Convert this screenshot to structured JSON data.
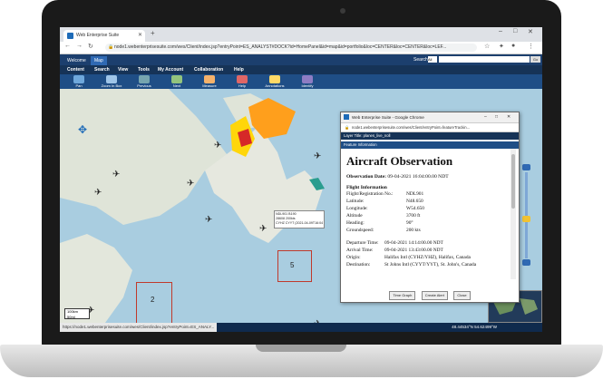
{
  "browser": {
    "tab_title": "Web Enterprise Suite",
    "url": "node1.webenterprisesuite.com/wes/Client/index.jsp?entryPoint=ES_ANALYST#DOCK?id=HomePanel&id=map&id=portfolio&loc=CENTER&loc=CENTER&loc=LEF..."
  },
  "app": {
    "tabs": [
      "Welcome",
      "Map"
    ],
    "search_label": "Search:",
    "search_scope": "All",
    "go_label": "Go",
    "menu": [
      "Content",
      "Search",
      "View",
      "Tools",
      "My Account",
      "Collaboration",
      "Help"
    ],
    "toolbar": [
      "Pan",
      "Zoom In Box",
      "Previous",
      "Next",
      "Measure",
      "Help",
      "Annotations",
      "Identify"
    ]
  },
  "map": {
    "boxes": [
      "2",
      "5"
    ],
    "scale": [
      "100km",
      "50mi"
    ],
    "flight_label": [
      "NDL901 B190",
      "28608 200kts",
      "CYHZ CYYT (2021-04-09T16:04:00Z)"
    ],
    "coordinates": "48.44534°N 54.62499°W",
    "status_url": "https://node1.webenterprisesuite.com/wes/Client/index.jsp?entryPoint=ES_ANALY..."
  },
  "popup": {
    "window_title": "Web Enterprise Suite - Google Chrome",
    "url": "node1.webenterprisesuite.com/wes/Client/entryPoint=featureTrackin...",
    "layer_title": "Layer Title: planes_live_noll",
    "feature_header": "Feature Information",
    "heading": "Aircraft Observation",
    "observation_date_label": "Observation Date:",
    "observation_date": "09-04-2021 16:04:00.00 NDT",
    "section_title": "Flight Information",
    "flight_rows": [
      {
        "key": "Flight/Registration No.:",
        "value": "NDL901"
      },
      {
        "key": "Latitude:",
        "value": "N48.650"
      },
      {
        "key": "Longitude:",
        "value": "W54.650"
      },
      {
        "key": "Altitude",
        "value": "3700 ft"
      },
      {
        "key": "Heading:",
        "value": "90°"
      },
      {
        "key": "Groundspeed:",
        "value": "200 kts"
      }
    ],
    "route_rows": [
      {
        "key": "Departure Time:",
        "value": "09-04-2021 14:14:00.00 NDT"
      },
      {
        "key": "Arrival Time:",
        "value": "09-04-2021 13:43:00.00 NDT"
      },
      {
        "key": "Origin:",
        "value": "Halifax Intl (CYHZ/YHZ), Halifax, Canada"
      },
      {
        "key": "Destination:",
        "value": "St Johns Intl (CYYT/YYT), St. John's, Canada"
      }
    ],
    "buttons": [
      "Time Graph",
      "Create Alert",
      "Close"
    ]
  }
}
